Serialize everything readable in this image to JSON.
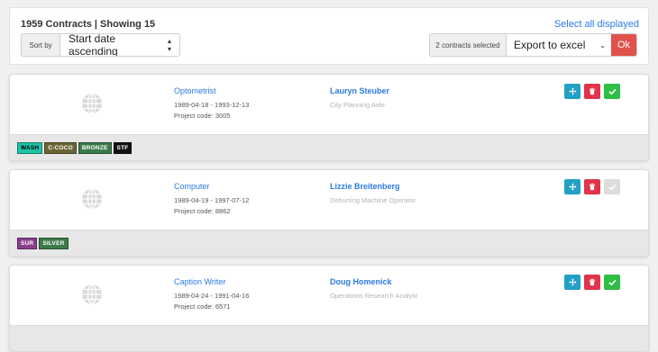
{
  "header": {
    "summary": "1959 Contracts | Showing 15",
    "select_all": "Select all displayed",
    "sort_label": "Sort by",
    "sort_value": "Start date ascending",
    "selected_count": "2 contracts selected",
    "export_value": "Export to excel",
    "ok_label": "Ok"
  },
  "icons": {
    "globe": "globe-icon",
    "move": "arrows-move-icon",
    "delete": "trash-icon",
    "approve": "check-icon",
    "sort_caret": "updown-caret-icon",
    "export_caret": "chevron-down-icon"
  },
  "colors": {
    "link": "#2a7ae2",
    "move": "#23a1c4",
    "delete": "#e0344a",
    "approve": "#2ebd45",
    "approve_disabled": "#dcdcdc",
    "ok": "#e0524c"
  },
  "contracts": [
    {
      "position": "Optometrist",
      "dates": "1989-04-18 - 1993-12-13",
      "project_code": "Project code: 3005",
      "person": "Lauryn Steuber",
      "role": "City Planning Aide",
      "approve_enabled": true,
      "tags": [
        {
          "label": "WASH",
          "bg": "#1fc3a7",
          "fg": "#000000"
        },
        {
          "label": "C-COCO",
          "bg": "#6b6434",
          "fg": "#ffffff"
        },
        {
          "label": "BRONZE",
          "bg": "#3d7a4a",
          "fg": "#ffffff"
        },
        {
          "label": "STF",
          "bg": "#111111",
          "fg": "#ffffff"
        }
      ]
    },
    {
      "position": "Computer",
      "dates": "1989-04-19 - 1997-07-12",
      "project_code": "Project code: 8862",
      "person": "Lizzie Breitenberg",
      "role": "Deburring Machine Operator",
      "approve_enabled": false,
      "tags": [
        {
          "label": "SUR",
          "bg": "#8a3e8e",
          "fg": "#ffffff"
        },
        {
          "label": "SILVER",
          "bg": "#3d7a4a",
          "fg": "#ffffff"
        }
      ]
    },
    {
      "position": "Caption Writer",
      "dates": "1989-04-24 - 1991-04-16",
      "project_code": "Project code: 6571",
      "person": "Doug Homenick",
      "role": "Operations Research Analyst",
      "approve_enabled": true,
      "tags": []
    }
  ]
}
